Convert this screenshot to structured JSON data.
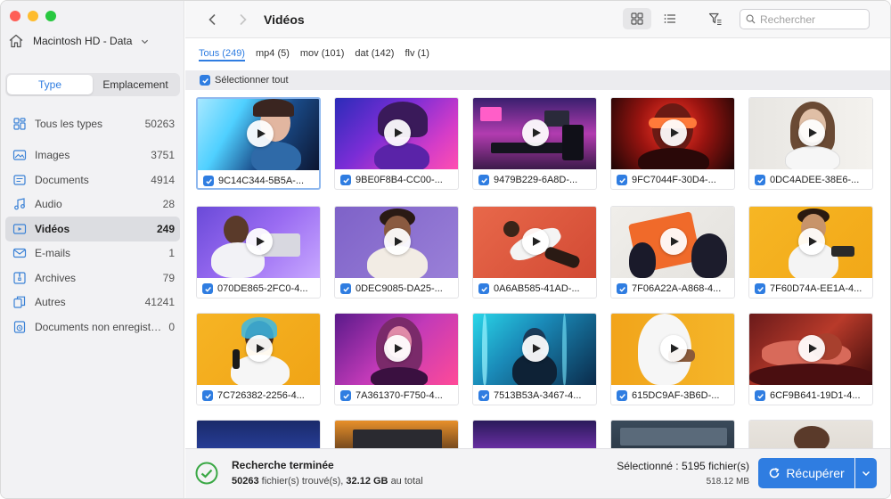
{
  "sidebar": {
    "disk_name": "Macintosh HD - Data",
    "tabs": [
      {
        "label": "Type",
        "active": true
      },
      {
        "label": "Emplacement",
        "active": false
      }
    ],
    "categories": [
      {
        "label": "Tous les types",
        "count": "50263",
        "icon": "stack-icon"
      },
      {
        "label": "Images",
        "count": "3751",
        "icon": "image-icon"
      },
      {
        "label": "Documents",
        "count": "4914",
        "icon": "document-icon"
      },
      {
        "label": "Audio",
        "count": "28",
        "icon": "music-note-icon"
      },
      {
        "label": "Vidéos",
        "count": "249",
        "icon": "video-icon",
        "selected": true
      },
      {
        "label": "E-mails",
        "count": "1",
        "icon": "envelope-icon"
      },
      {
        "label": "Archives",
        "count": "79",
        "icon": "archive-icon"
      },
      {
        "label": "Autres",
        "count": "41241",
        "icon": "copy-icon"
      },
      {
        "label": "Documents non enregistrés",
        "count": "0",
        "icon": "unsaved-document-icon"
      }
    ]
  },
  "toolbar": {
    "title": "Vidéos",
    "search_placeholder": "Rechercher"
  },
  "filters": [
    {
      "label": "Tous (249)",
      "active": true
    },
    {
      "label": "mp4 (5)",
      "active": false
    },
    {
      "label": "mov (101)",
      "active": false
    },
    {
      "label": "dat (142)",
      "active": false
    },
    {
      "label": "flv (1)",
      "active": false
    }
  ],
  "select_all_label": "Sélectionner tout",
  "files": [
    {
      "name": "9C14C344-5B5A-...",
      "checked": true,
      "selected": true
    },
    {
      "name": "9BE0F8B4-CC00-...",
      "checked": true
    },
    {
      "name": "9479B229-6A8D-...",
      "checked": true
    },
    {
      "name": "9FC7044F-30D4-...",
      "checked": true
    },
    {
      "name": "0DC4ADEE-38E6-...",
      "checked": true
    },
    {
      "name": "070DE865-2FC0-4...",
      "checked": true
    },
    {
      "name": "0DEC9085-DA25-...",
      "checked": true
    },
    {
      "name": "0A6AB585-41AD-...",
      "checked": true
    },
    {
      "name": "7F06A22A-A868-4...",
      "checked": true
    },
    {
      "name": "7F60D74A-EE1A-4...",
      "checked": true
    },
    {
      "name": "7C726382-2256-4...",
      "checked": true
    },
    {
      "name": "7A361370-F750-4...",
      "checked": true
    },
    {
      "name": "7513B53A-3467-4...",
      "checked": true
    },
    {
      "name": "615DC9AF-3B6D-...",
      "checked": true
    },
    {
      "name": "6CF9B641-19D1-4...",
      "checked": true
    }
  ],
  "footer": {
    "status_title": "Recherche terminée",
    "found_count": "50263",
    "found_label": "fichier(s) trouvé(s),",
    "total_size": "32.12 GB",
    "total_label": "au total",
    "selected_text": "Sélectionné : 5195 fichier(s)",
    "selected_size": "518.12 MB",
    "recover_label": "Récupérer"
  },
  "colors": {
    "accent": "#2f7de1",
    "success": "#3aa845"
  }
}
